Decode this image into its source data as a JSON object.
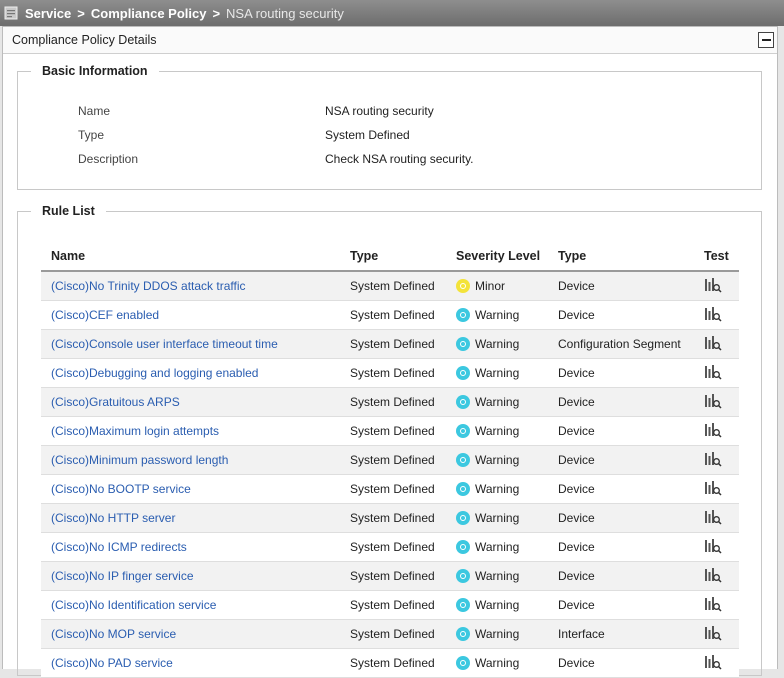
{
  "breadcrumb": {
    "items": [
      "Service",
      "Compliance Policy"
    ],
    "separator": ">",
    "current": "NSA routing security"
  },
  "panel": {
    "title": "Compliance Policy Details",
    "collapse_icon": "minus-icon"
  },
  "basic_info": {
    "legend": "Basic Information",
    "rows": [
      {
        "label": "Name",
        "value": "NSA routing security"
      },
      {
        "label": "Type",
        "value": "System Defined"
      },
      {
        "label": "Description",
        "value": "Check NSA routing security."
      }
    ]
  },
  "rule_list": {
    "legend": "Rule List",
    "columns": [
      "Name",
      "Type",
      "Severity Level",
      "Type",
      "Test"
    ],
    "severity_colors": {
      "Minor": "#f3e33a",
      "Warning": "#3cc8e0"
    },
    "rows": [
      {
        "name": "(Cisco)No Trinity DDOS attack traffic",
        "type": "System Defined",
        "severity": "Minor",
        "target": "Device"
      },
      {
        "name": "(Cisco)CEF enabled",
        "type": "System Defined",
        "severity": "Warning",
        "target": "Device"
      },
      {
        "name": "(Cisco)Console user interface timeout time",
        "type": "System Defined",
        "severity": "Warning",
        "target": "Configuration Segment"
      },
      {
        "name": "(Cisco)Debugging and logging enabled",
        "type": "System Defined",
        "severity": "Warning",
        "target": "Device"
      },
      {
        "name": "(Cisco)Gratuitous ARPS",
        "type": "System Defined",
        "severity": "Warning",
        "target": "Device"
      },
      {
        "name": "(Cisco)Maximum login attempts",
        "type": "System Defined",
        "severity": "Warning",
        "target": "Device"
      },
      {
        "name": "(Cisco)Minimum password length",
        "type": "System Defined",
        "severity": "Warning",
        "target": "Device"
      },
      {
        "name": "(Cisco)No BOOTP service",
        "type": "System Defined",
        "severity": "Warning",
        "target": "Device"
      },
      {
        "name": "(Cisco)No HTTP server",
        "type": "System Defined",
        "severity": "Warning",
        "target": "Device"
      },
      {
        "name": "(Cisco)No ICMP redirects",
        "type": "System Defined",
        "severity": "Warning",
        "target": "Device"
      },
      {
        "name": "(Cisco)No IP finger service",
        "type": "System Defined",
        "severity": "Warning",
        "target": "Device"
      },
      {
        "name": "(Cisco)No Identification service",
        "type": "System Defined",
        "severity": "Warning",
        "target": "Device"
      },
      {
        "name": "(Cisco)No MOP service",
        "type": "System Defined",
        "severity": "Warning",
        "target": "Interface"
      },
      {
        "name": "(Cisco)No PAD service",
        "type": "System Defined",
        "severity": "Warning",
        "target": "Device"
      }
    ]
  }
}
